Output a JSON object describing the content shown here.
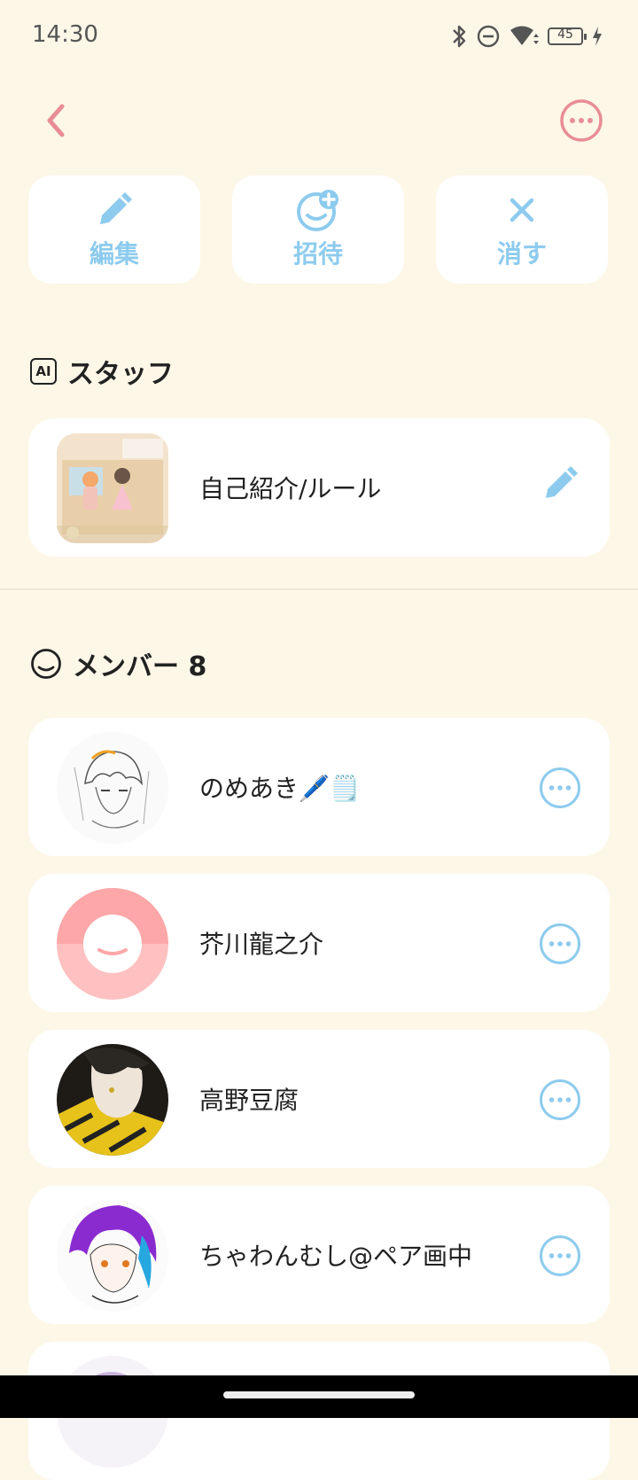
{
  "status_bar": {
    "time": "14:30",
    "battery_level": "45"
  },
  "header": {
    "back_icon": "chevron-left-icon",
    "more_icon": "more-horizontal-icon"
  },
  "actions": [
    {
      "label": "編集",
      "icon": "pencil-icon"
    },
    {
      "label": "招待",
      "icon": "add-smile-icon"
    },
    {
      "label": "消す",
      "icon": "close-icon"
    }
  ],
  "staff_section": {
    "title": "スタッフ",
    "badge": "AI",
    "items": [
      {
        "name": "自己紹介/ルール",
        "icon": "pencil-icon"
      }
    ]
  },
  "members_section": {
    "title": "メンバー 8",
    "members": [
      {
        "name": "のめあき🖊️🗒️"
      },
      {
        "name": "芥川龍之介"
      },
      {
        "name": "高野豆腐"
      },
      {
        "name": "ちゃわんむし@ペア画中"
      }
    ]
  },
  "colors": {
    "background": "#fdf7e8",
    "accent_blue": "#8dcbee",
    "accent_pink": "#e88d96"
  }
}
